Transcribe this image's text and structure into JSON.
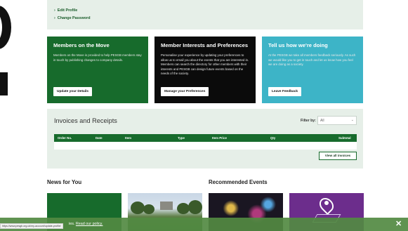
{
  "profile_links": {
    "edit_profile": "Edit Profile",
    "change_password": "Change Password"
  },
  "cards": [
    {
      "title": "Members on the Move",
      "body": "Members on the Move is provided to help PESGB members stay in touch by publishing changes to company details.",
      "button": "Update your Details",
      "color": "#176b2c"
    },
    {
      "title": "Member Interests and Preferences",
      "body": "Personalise your experience by updating your preferences to allow us to email you about the events that you are interested in. Members can search the directory for other members with their interests and PESGB can design future events based on the needs of the society.",
      "button": "Manage your Preferences",
      "color": "#0b0b0b"
    },
    {
      "title": "Tell us how we're doing",
      "body": "At the PESGB we take all members feedback seriously. As such we would like you to get in touch and let us know how you feel we are doing as a society.",
      "button": "Leave Feedback",
      "color": "#3db4c7"
    }
  ],
  "invoices": {
    "title": "Invoices and Receipts",
    "filter_label": "Filter by:",
    "filter_value": "All",
    "columns": [
      "Order No.",
      "Date",
      "Item",
      "Type",
      "Item Price",
      "Qty",
      "Subtotal"
    ],
    "view_all": "View all invoices"
  },
  "sections": {
    "news": "News for You",
    "events": "Recommended Events"
  },
  "cookie": {
    "text_partial": "ies.",
    "policy_link": "Read our policy."
  },
  "status_url": "https://www.pesgb.org.uk/my-account/update-profile/",
  "icons": {
    "link_chevron": "chevron-right-icon",
    "select_chevron": "chevron-down-icon",
    "close": "close-icon"
  }
}
